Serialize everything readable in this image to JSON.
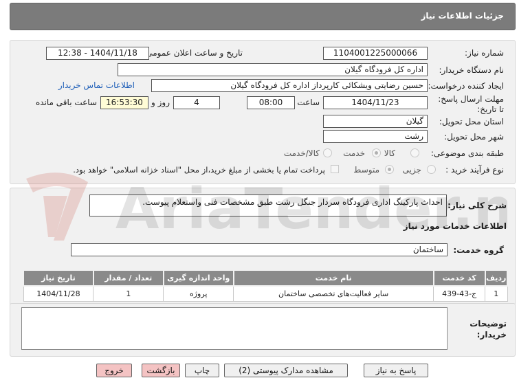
{
  "header": {
    "title": "جزئیات اطلاعات نیاز"
  },
  "form": {
    "need_number_label": "شماره نیاز:",
    "need_number": "1104001225000066",
    "announce_label": "تاریخ و ساعت اعلان عمومی:",
    "announce_value": "1404/11/18 - 12:38",
    "buyer_org_label": "نام دستگاه خریدار:",
    "buyer_org": "اداره کل فرودگاه گیلان",
    "creator_label": "ایجاد کننده درخواست:",
    "creator": "حسین رضایتی ویشکائی کارپرداز اداره کل فرودگاه گیلان",
    "contact_link": "اطلاعات تماس خریدار",
    "deadline_label": "مهلت ارسال پاسخ: تا تاریخ:",
    "deadline_date": "1404/11/23",
    "time_label": "ساعت",
    "deadline_time": "08:00",
    "days_value": "4",
    "days_label": "روز و",
    "remaining_time": "16:53:30",
    "remaining_label": "ساعت باقی مانده",
    "province_label": "استان محل تحویل:",
    "province": "گیلان",
    "city_label": "شهر محل تحویل:",
    "city": "رشت",
    "category_label": "طبقه بندی موضوعی:",
    "category_options": [
      "کالا",
      "خدمت",
      "کالا/خدمت"
    ],
    "category_selected": "خدمت",
    "process_label": "نوع فرآیند خرید :",
    "process_options": [
      "جزیی",
      "متوسط"
    ],
    "process_selected": "متوسط",
    "payment_note": "پرداخت تمام یا بخشی از مبلغ خرید،از محل \"اسناد خزانه اسلامی\" خواهد بود."
  },
  "description": {
    "label": "شرح کلی نیاز:",
    "text": "احداث پارکینگ اداری فرودگاه سردار جنگل رشت طبق مشخصات فنی واستعلام پیوست."
  },
  "services": {
    "section_title": "اطلاعات خدمات مورد نیاز",
    "group_label": "گروه خدمت:",
    "group_value": "ساختمان",
    "columns": [
      "ردیف",
      "کد خدمت",
      "نام خدمت",
      "واحد اندازه گیری",
      "تعداد / مقدار",
      "تاریخ نیاز"
    ],
    "rows": [
      [
        "1",
        "ج-43-439",
        "سایر فعالیت‌های تخصصی ساختمان",
        "پروژه",
        "1",
        "1404/11/28"
      ]
    ]
  },
  "buyer_notes": {
    "label": "توضیحات خریدار:",
    "value": ""
  },
  "buttons": {
    "reply": "پاسخ به نیاز",
    "docs": "مشاهده مدارک پیوستی (2)",
    "print": "چاپ",
    "back": "بازگشت",
    "exit": "خروج"
  },
  "watermark": {
    "text": "AriaTender.net"
  },
  "colors": {
    "header_bg": "#7b7b7b",
    "table_header_bg": "#8a8a8a",
    "link": "#1f5fb8",
    "pink_button": "#f4c3c3"
  }
}
